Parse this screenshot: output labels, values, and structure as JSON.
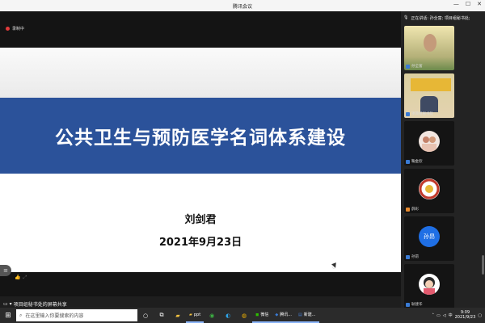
{
  "window": {
    "title": "腾讯会议",
    "min": "—",
    "max": "☐",
    "close": "✕"
  },
  "recording": {
    "label": "录制中"
  },
  "slide": {
    "title": "公共卫生与预防医学名词体系建设",
    "author": "刘剑君",
    "date": "2021年9月23日"
  },
  "share_status": "项目组秘书处的屏幕共享",
  "speaker": {
    "text": "正在讲话: 孙全富; 项目组秘书处;"
  },
  "participants": [
    {
      "name": "孙全富",
      "type": "video1"
    },
    {
      "name": "项目组秘书处",
      "type": "video2"
    },
    {
      "name": "鞠金欣",
      "type": "avatar"
    },
    {
      "name": "薛彩",
      "type": "avatar"
    },
    {
      "name": "孙昂",
      "type": "text",
      "avatar_text": "孙昂"
    },
    {
      "name": "耿建华",
      "type": "avatar"
    }
  ],
  "taskbar": {
    "search_placeholder": "在这里输入你要搜索的内容",
    "apps": [
      "ppt",
      "微信",
      "腾讯...",
      "新建..."
    ],
    "time": "9:09",
    "date": "2021/9/23",
    "lang": "中"
  },
  "colors": {
    "accent": "#2b529a",
    "record": "#e23b3b",
    "avatar_blue": "#1f6fe5"
  }
}
